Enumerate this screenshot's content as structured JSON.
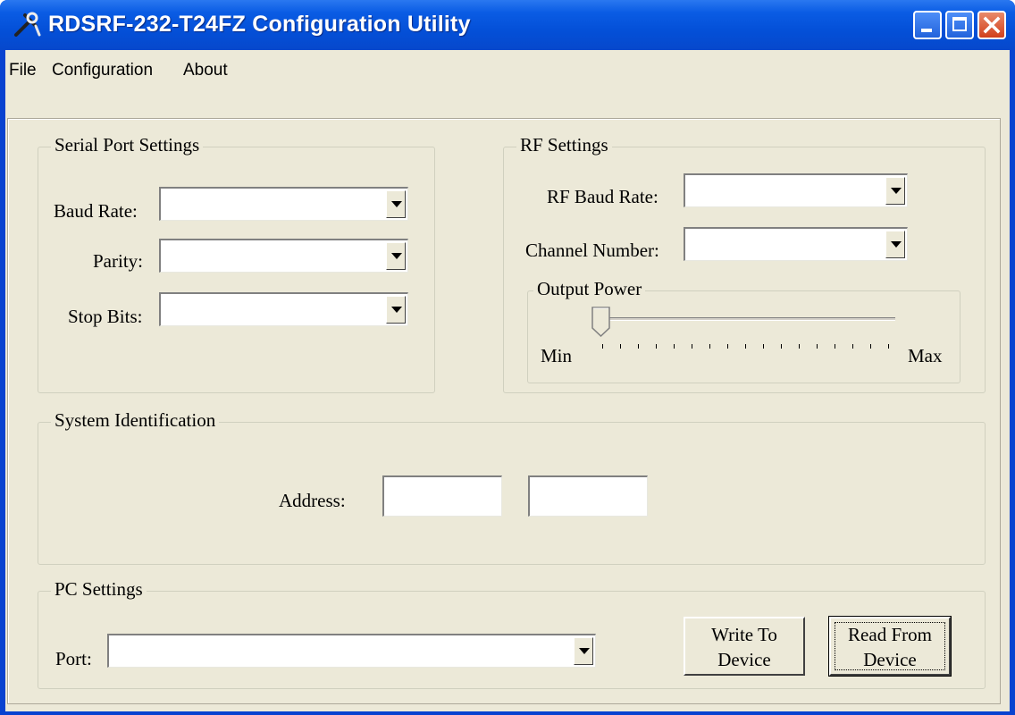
{
  "window": {
    "title": "RDSRF-232-T24FZ Configuration Utility",
    "icon": "tools-icon"
  },
  "menu": [
    "File",
    "Configuration",
    "About"
  ],
  "serial_port": {
    "title": "Serial Port Settings",
    "baud_rate_label": "Baud Rate:",
    "baud_rate_value": "",
    "parity_label": "Parity:",
    "parity_value": "",
    "stop_bits_label": "Stop Bits:",
    "stop_bits_value": ""
  },
  "rf": {
    "title": "RF Settings",
    "rf_baud_rate_label": "RF Baud Rate:",
    "rf_baud_rate_value": "",
    "channel_label": "Channel Number:",
    "channel_value": "",
    "output_power": {
      "title": "Output Power",
      "min_label": "Min",
      "max_label": "Max",
      "level": 0
    }
  },
  "system_identification": {
    "title": "System Identification",
    "address_label": "Address:",
    "address_1": "",
    "address_2": ""
  },
  "pc": {
    "title": "PC Settings",
    "port_label": "Port:",
    "port_value": "",
    "write_line1": "Write To",
    "write_line2": "Device",
    "read_line1": "Read From",
    "read_line2": "Device"
  },
  "colors": {
    "titlebar": "#0450d8",
    "face": "#ece9d8",
    "close": "#d2401c"
  }
}
